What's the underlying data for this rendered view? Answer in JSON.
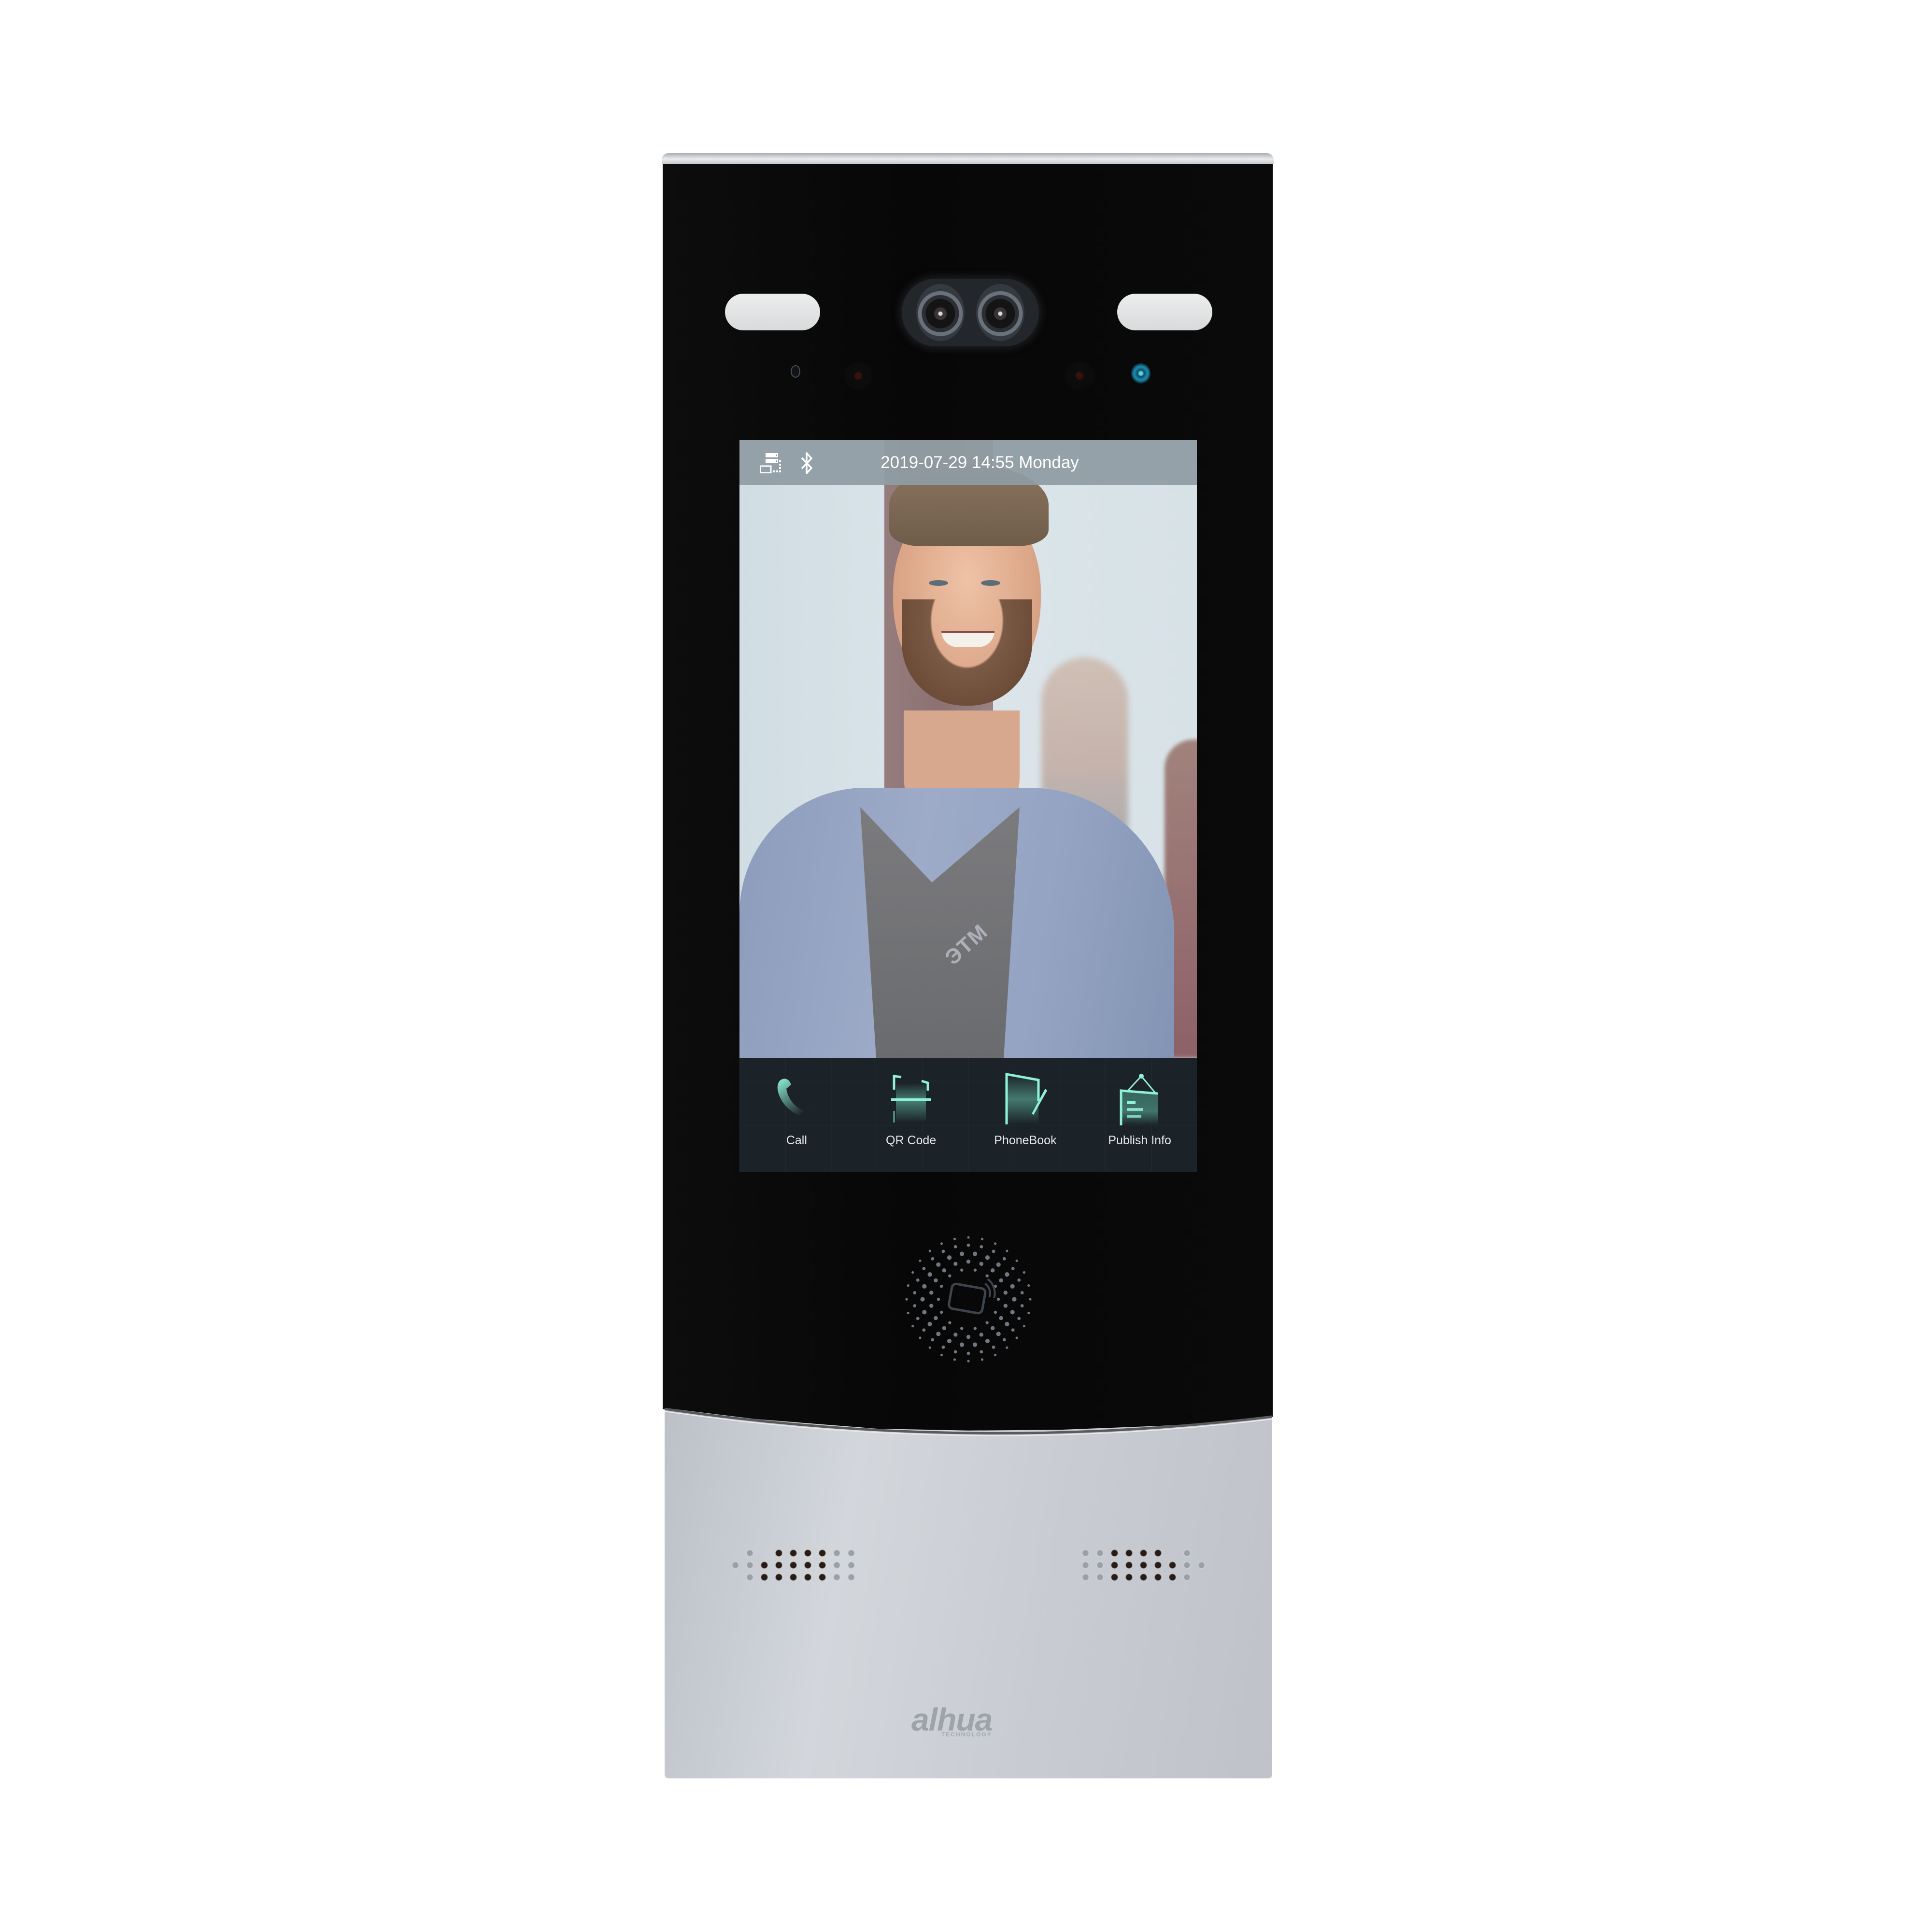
{
  "device": {
    "brand_logo": "alhua",
    "brand_sub": "TECHNOLOGY",
    "colors": {
      "front_glass": "#0a0a0a",
      "bottom_plate": "#c9cdd3",
      "accent_icon": "#7fdcc6",
      "status_led_blue": "#27a3c6"
    }
  },
  "screen": {
    "status_bar": {
      "icons": [
        "network-icon",
        "bluetooth-icon"
      ],
      "datetime": "2019-07-29 14:55 Monday"
    },
    "camera_feed": {
      "watermark": "ЭТМ"
    },
    "tabs": [
      {
        "label": "Call",
        "icon": "phone-handset-icon"
      },
      {
        "label": "QR Code",
        "icon": "qr-scan-icon"
      },
      {
        "label": "PhoneBook",
        "icon": "phonebook-icon"
      },
      {
        "label": "Publish Info",
        "icon": "notice-board-icon"
      }
    ]
  },
  "nfc": {
    "icon": "card-reader-icon"
  }
}
